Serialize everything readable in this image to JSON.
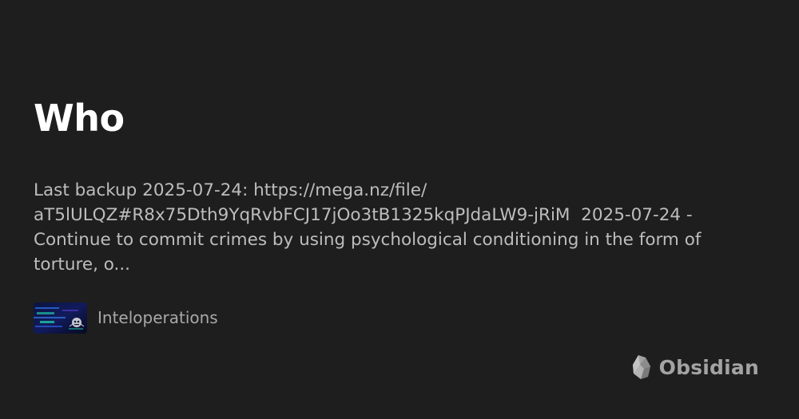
{
  "page": {
    "title": "Who",
    "description": "Last backup 2025-07-24: https://mega.nz/file/\naT5lULQZ#R8x75Dth9YqRvbFCJ17jOo3tB1325kqPJdaLW9-jRiM  2025-07-24 -\nContinue to commit crimes by using psychological conditioning in the form of\ntorture, o..."
  },
  "site": {
    "name": "Inteloperations",
    "thumbnail_icon": "site-thumbnail-image"
  },
  "brand": {
    "name": "Obsidian",
    "icon": "obsidian-logo-icon"
  },
  "colors": {
    "background": "#1e1e1e",
    "title": "#ffffff",
    "description": "#bdbdbd",
    "muted": "#a8a8a8"
  }
}
